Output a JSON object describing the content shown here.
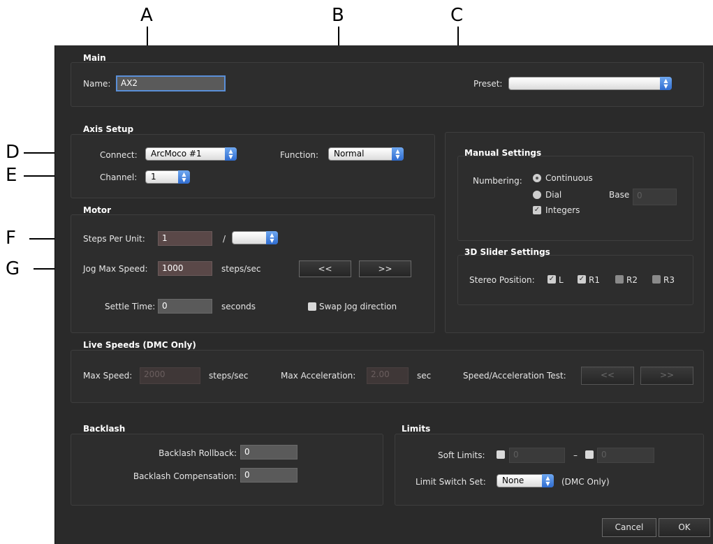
{
  "callouts": {
    "a": "A",
    "b": "B",
    "c": "C",
    "d": "D",
    "e": "E",
    "f": "F",
    "g": "G"
  },
  "main": {
    "section": "Main",
    "name_label": "Name:",
    "name_value": "AX2",
    "preset_label": "Preset:",
    "preset_value": ""
  },
  "axis": {
    "section": "Axis Setup",
    "connect_label": "Connect:",
    "connect_value": "ArcMoco #1",
    "function_label": "Function:",
    "function_value": "Normal",
    "channel_label": "Channel:",
    "channel_value": "1"
  },
  "motor": {
    "section": "Motor",
    "steps_label": "Steps Per Unit:",
    "steps_value": "1",
    "slash": "/",
    "unit_value": "",
    "jog_label": "Jog Max Speed:",
    "jog_value": "1000",
    "jog_unit": "steps/sec",
    "jog_back": "<<",
    "jog_fwd": ">>",
    "settle_label": "Settle Time:",
    "settle_value": "0",
    "settle_unit": "seconds",
    "swap_label": "Swap Jog direction"
  },
  "manual": {
    "section": "Manual Settings",
    "numbering_label": "Numbering:",
    "continuous": "Continuous",
    "dial": "Dial",
    "integers": "Integers",
    "base_label": "Base",
    "base_value": "0"
  },
  "slider3d": {
    "section": "3D Slider Settings",
    "stereo_label": "Stereo Position:",
    "l": "L",
    "r1": "R1",
    "r2": "R2",
    "r3": "R3"
  },
  "live": {
    "section": "Live Speeds (DMC Only)",
    "max_speed_label": "Max Speed:",
    "max_speed_value": "2000",
    "max_speed_unit": "steps/sec",
    "max_acc_label": "Max Acceleration:",
    "max_acc_value": "2.00",
    "max_acc_unit": "sec",
    "test_label": "Speed/Acceleration Test:",
    "test_back": "<<",
    "test_fwd": ">>"
  },
  "backlash": {
    "section": "Backlash",
    "rollback_label": "Backlash Rollback:",
    "rollback_value": "0",
    "comp_label": "Backlash Compensation:",
    "comp_value": "0"
  },
  "limits": {
    "section": "Limits",
    "soft_label": "Soft Limits:",
    "soft_min": "0",
    "dash": "–",
    "soft_max": "0",
    "switch_label": "Limit Switch Set:",
    "switch_value": "None",
    "switch_note": "(DMC Only)"
  },
  "footer": {
    "cancel": "Cancel",
    "ok": "OK"
  },
  "colors": {
    "dialog_bg": "#2a2a2a",
    "popup_accent": "#2f6cd0",
    "field_bg": "#5a4848"
  }
}
